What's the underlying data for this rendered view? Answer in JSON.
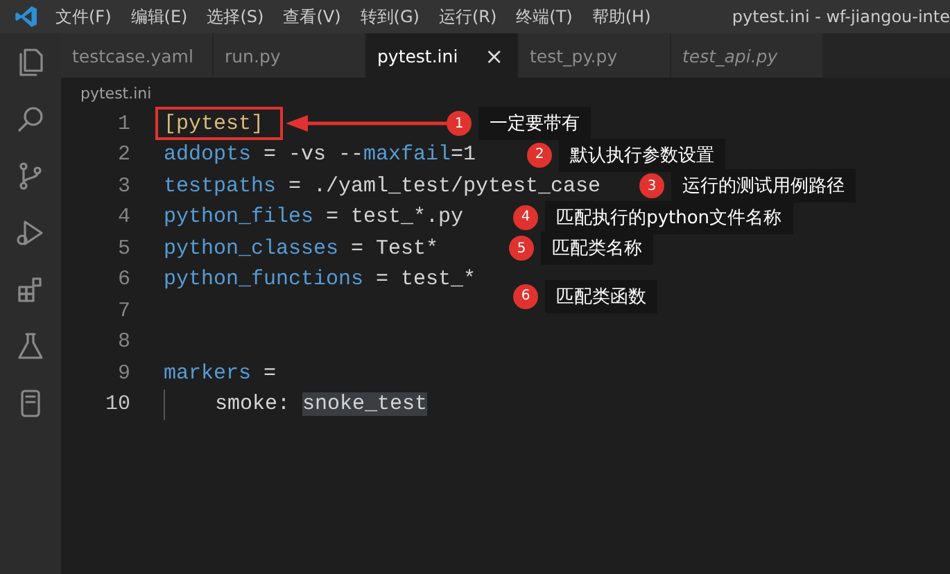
{
  "menu_bar": {
    "items": [
      "文件(F)",
      "编辑(E)",
      "选择(S)",
      "查看(V)",
      "转到(G)",
      "运行(R)",
      "终端(T)",
      "帮助(H)"
    ],
    "title": "pytest.ini - wf-jiangou-inte"
  },
  "tabs": [
    {
      "label": "testcase.yaml",
      "selected": false,
      "preview": false
    },
    {
      "label": "run.py",
      "selected": false,
      "preview": false
    },
    {
      "label": "pytest.ini",
      "selected": true,
      "preview": false,
      "close": "×"
    },
    {
      "label": "test_py.py",
      "selected": false,
      "preview": false
    },
    {
      "label": "test_api.py",
      "selected": false,
      "preview": true
    }
  ],
  "breadcrumb": "pytest.ini",
  "editor": {
    "lines": [
      {
        "number": "1",
        "current": false,
        "tokens": [
          {
            "kind": "section",
            "text": "[pytest]"
          }
        ],
        "boxed": true,
        "callout": {
          "number": "1",
          "text": "一定要带有"
        }
      },
      {
        "number": "2",
        "current": false,
        "tokens": [
          {
            "kind": "key",
            "text": "addopts"
          },
          {
            "kind": "plain",
            "text": " = -vs --"
          },
          {
            "kind": "key",
            "text": "maxfail"
          },
          {
            "kind": "plain",
            "text": "=1"
          }
        ],
        "callout": {
          "number": "2",
          "text": "默认执行参数设置"
        }
      },
      {
        "number": "3",
        "current": false,
        "tokens": [
          {
            "kind": "key",
            "text": "testpaths"
          },
          {
            "kind": "plain",
            "text": " = ./yaml_test/pytest_case"
          }
        ],
        "callout": {
          "number": "3",
          "text": "运行的测试用例路径"
        }
      },
      {
        "number": "4",
        "current": false,
        "tokens": [
          {
            "kind": "key",
            "text": "python_files"
          },
          {
            "kind": "plain",
            "text": " = test_*.py"
          }
        ],
        "callout": {
          "number": "4",
          "text": "匹配执行的python文件名称"
        }
      },
      {
        "number": "5",
        "current": false,
        "tokens": [
          {
            "kind": "key",
            "text": "python_classes"
          },
          {
            "kind": "plain",
            "text": " = Test*"
          }
        ],
        "callout": {
          "number": "5",
          "text": "匹配类名称"
        }
      },
      {
        "number": "6",
        "current": false,
        "tokens": [
          {
            "kind": "key",
            "text": "python_functions"
          },
          {
            "kind": "plain",
            "text": " = test_*"
          }
        ],
        "callout": {
          "number": "6",
          "text": "匹配类函数"
        }
      },
      {
        "number": "7",
        "current": false
      },
      {
        "number": "8",
        "current": false
      },
      {
        "number": "9",
        "current": false,
        "tokens": [
          {
            "kind": "key",
            "text": "markers"
          },
          {
            "kind": "plain",
            "text": " ="
          }
        ]
      },
      {
        "number": "10",
        "current": true,
        "tokens": [
          {
            "kind": "indent"
          },
          {
            "kind": "plain",
            "text": "smoke: "
          },
          {
            "kind": "highlight",
            "text": "snoke_test"
          }
        ]
      }
    ]
  }
}
